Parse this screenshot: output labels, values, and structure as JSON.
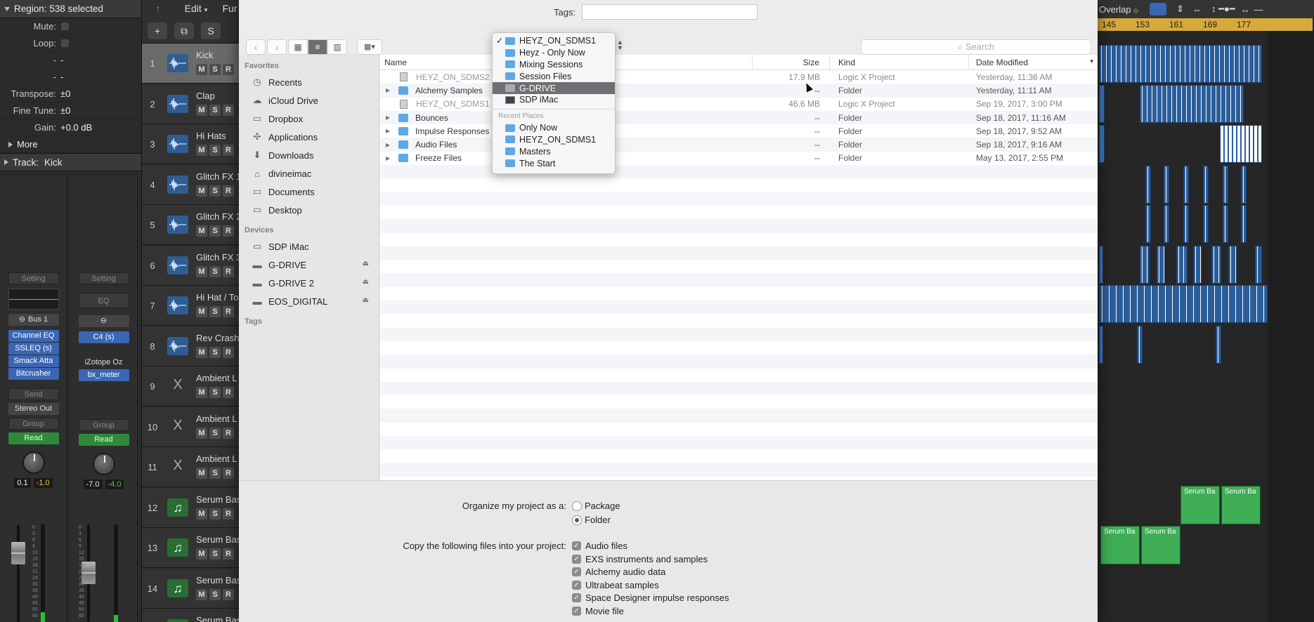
{
  "inspector": {
    "region_header": "Region: 538 selected",
    "rows": [
      {
        "label": "Mute:",
        "value": ""
      },
      {
        "label": "Loop:",
        "value": ""
      },
      {
        "label": "-",
        "value": "-"
      },
      {
        "label": "-",
        "value": "-"
      },
      {
        "label": "Transpose:",
        "value": "±0"
      },
      {
        "label": "Fine Tune:",
        "value": "±0"
      },
      {
        "label": "Gain:",
        "value": "+0.0 dB"
      }
    ],
    "more_label": "More",
    "track_header": "Track:",
    "track_name": "Kick",
    "strip1": {
      "setting": "Setting",
      "bus": "Bus 1",
      "plugins": [
        "Channel EQ",
        "SSLEQ (s)",
        "Smack Atta",
        "Bitcrusher"
      ],
      "send": "Send",
      "output": "Stereo Out",
      "group": "Group",
      "read": "Read",
      "pan_value": "0.1",
      "level_value": "-1.0"
    },
    "strip2": {
      "setting": "Setting",
      "eq": "EQ",
      "plugins": [
        "C4 (s)",
        "",
        "iZotope Oz",
        "bx_meter"
      ],
      "group": "Group",
      "read": "Read",
      "pan_value": "-7.0",
      "level_value": "-4.0"
    },
    "scale_marks": [
      "0",
      "3",
      "6",
      "9",
      "12",
      "15",
      "18",
      "21",
      "24",
      "30",
      "35",
      "40",
      "45",
      "50",
      "60"
    ]
  },
  "track_toolbar": {
    "back": "↑",
    "edit": "Edit",
    "functions": "Fur",
    "add": "+",
    "s": "S"
  },
  "tracks": [
    {
      "num": "1",
      "name": "Kick",
      "type": "audio",
      "selected": true
    },
    {
      "num": "2",
      "name": "Clap",
      "type": "audio"
    },
    {
      "num": "3",
      "name": "Hi Hats",
      "type": "audio"
    },
    {
      "num": "4",
      "name": "Glitch FX 1",
      "type": "audio"
    },
    {
      "num": "5",
      "name": "Glitch FX 2",
      "type": "audio"
    },
    {
      "num": "6",
      "name": "Glitch FX 3",
      "type": "audio"
    },
    {
      "num": "7",
      "name": "Hi Hat / To",
      "type": "audio"
    },
    {
      "num": "8",
      "name": "Rev Crash",
      "type": "audio"
    },
    {
      "num": "9",
      "name": "Ambient L",
      "type": "gear"
    },
    {
      "num": "10",
      "name": "Ambient L",
      "type": "gear"
    },
    {
      "num": "11",
      "name": "Ambient L",
      "type": "gear"
    },
    {
      "num": "12",
      "name": "Serum Bas",
      "type": "midi"
    },
    {
      "num": "13",
      "name": "Serum Bas",
      "type": "midi"
    },
    {
      "num": "14",
      "name": "Serum Bas",
      "type": "midi"
    },
    {
      "num": "",
      "name": "Serum Bas",
      "type": "midi"
    }
  ],
  "ms_labels": {
    "m": "M",
    "s": "S",
    "r": "R"
  },
  "arrange": {
    "toolbar_overlap": "Overlap",
    "ruler": [
      "145",
      "153",
      "161",
      "169",
      "177"
    ],
    "green_regions": [
      "Serum Ba",
      "Serum Ba",
      "Serum Ba",
      "Serum Ba"
    ]
  },
  "dialog": {
    "tags_label": "Tags:",
    "search_placeholder": "Search",
    "sidebar": {
      "favorites_header": "Favorites",
      "favorites": [
        {
          "label": "Recents",
          "icon": "clock-icon"
        },
        {
          "label": "iCloud Drive",
          "icon": "cloud-icon"
        },
        {
          "label": "Dropbox",
          "icon": "folder-icon"
        },
        {
          "label": "Applications",
          "icon": "applications-icon"
        },
        {
          "label": "Downloads",
          "icon": "download-icon"
        },
        {
          "label": "divineimac",
          "icon": "home-icon"
        },
        {
          "label": "Documents",
          "icon": "folder-icon"
        },
        {
          "label": "Desktop",
          "icon": "folder-icon"
        }
      ],
      "devices_header": "Devices",
      "devices": [
        {
          "label": "SDP iMac",
          "icon": "imac-icon",
          "eject": false
        },
        {
          "label": "G-DRIVE",
          "icon": "drive-icon",
          "eject": true
        },
        {
          "label": "G-DRIVE 2",
          "icon": "drive-icon",
          "eject": true
        },
        {
          "label": "EOS_DIGITAL",
          "icon": "drive-icon",
          "eject": true
        }
      ],
      "tags_header": "Tags"
    },
    "columns": {
      "name": "Name",
      "size": "Size",
      "kind": "Kind",
      "date": "Date Modified"
    },
    "files": [
      {
        "name": "HEYZ_ON_SDMS2",
        "size": "17.9 MB",
        "kind": "Logic X Project",
        "date": "Yesterday, 11:36 AM",
        "type": "doc",
        "dim": true
      },
      {
        "name": "Alchemy Samples",
        "size": "--",
        "kind": "Folder",
        "date": "Yesterday, 11:11 AM",
        "type": "folder"
      },
      {
        "name": "HEYZ_ON_SDMS1",
        "size": "46.6 MB",
        "kind": "Logic X Project",
        "date": "Sep 19, 2017, 3:00 PM",
        "type": "doc",
        "dim": true
      },
      {
        "name": "Bounces",
        "size": "--",
        "kind": "Folder",
        "date": "Sep 18, 2017, 11:16 AM",
        "type": "folder"
      },
      {
        "name": "Impulse Responses",
        "size": "--",
        "kind": "Folder",
        "date": "Sep 18, 2017, 9:52 AM",
        "type": "folder"
      },
      {
        "name": "Audio Files",
        "size": "--",
        "kind": "Folder",
        "date": "Sep 18, 2017, 9:16 AM",
        "type": "folder"
      },
      {
        "name": "Freeze Files",
        "size": "--",
        "kind": "Folder",
        "date": "May 13, 2017, 2:55 PM",
        "type": "folder"
      }
    ],
    "location_popup": {
      "items": [
        {
          "label": "HEYZ_ON_SDMS1",
          "icon": "folder",
          "checked": true
        },
        {
          "label": "Heyz - Only Now",
          "icon": "folder"
        },
        {
          "label": "Mixing Sessions",
          "icon": "folder"
        },
        {
          "label": "Session Files",
          "icon": "folder"
        },
        {
          "label": "G-DRIVE",
          "icon": "drive",
          "highlighted": true
        },
        {
          "label": "SDP iMac",
          "icon": "imac"
        }
      ],
      "recent_header": "Recent Places",
      "recent": [
        {
          "label": "Only Now"
        },
        {
          "label": "HEYZ_ON_SDMS1"
        },
        {
          "label": "Masters"
        },
        {
          "label": "The Start"
        }
      ]
    },
    "organize_label": "Organize my project as a:",
    "organize_options": [
      {
        "label": "Package",
        "selected": false
      },
      {
        "label": "Folder",
        "selected": true
      }
    ],
    "copy_label": "Copy the following files into your project:",
    "copy_options": [
      {
        "label": "Audio files",
        "checked": true
      },
      {
        "label": "EXS instruments and samples",
        "checked": true
      },
      {
        "label": "Alchemy audio data",
        "checked": true
      },
      {
        "label": "Ultrabeat samples",
        "checked": true
      },
      {
        "label": "Space Designer impulse responses",
        "checked": true
      },
      {
        "label": "Movie file",
        "checked": true
      }
    ]
  }
}
